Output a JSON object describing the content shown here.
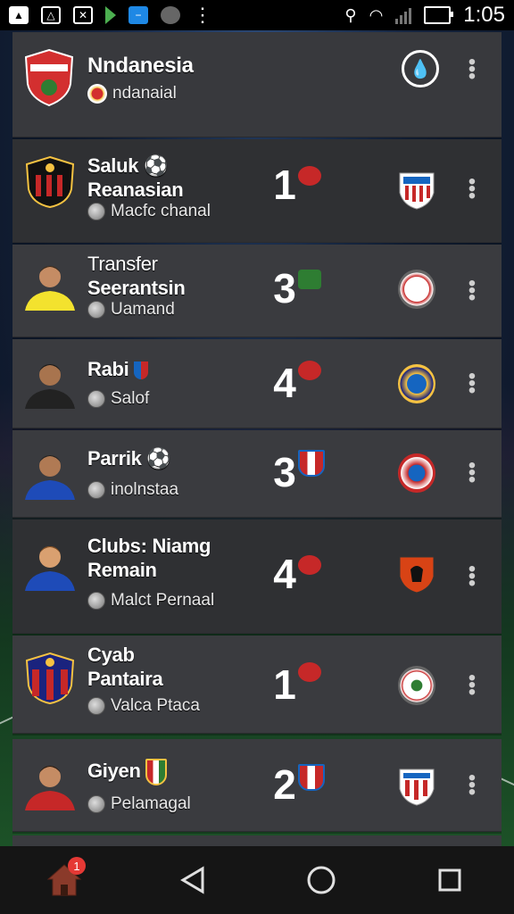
{
  "status_bar": {
    "time": "1:05"
  },
  "header": {
    "title": "Nndanesia",
    "subtitle": "ndanaial"
  },
  "rows": [
    {
      "title_line1": "Saluk",
      "title_line2": "Reanasian",
      "subtitle": "Macfc chanal",
      "score": "1"
    },
    {
      "title_line1": "Transfer",
      "title_line2": "Seerantsin",
      "subtitle": "Uamand",
      "score": "3"
    },
    {
      "title_line1": "Rabi",
      "title_line2": "",
      "subtitle": "Salof",
      "score": "4"
    },
    {
      "title_line1": "Parrik",
      "title_line2": "",
      "subtitle": "inolnstaa",
      "score": "3"
    },
    {
      "title_line1": "Clubs: Niamg",
      "title_line2": "Remain",
      "subtitle": "Malct Pernaal",
      "score": "4"
    },
    {
      "title_line1": "Cyab",
      "title_line2": "Pantaira",
      "subtitle": "Valca Ptaca",
      "score": "1"
    },
    {
      "title_line1": "Giyen",
      "title_line2": "",
      "subtitle": "Pelamagal",
      "score": "2"
    }
  ],
  "nav": {
    "home_badge": "1"
  },
  "colors": {
    "row_bg": "#3a3b3f",
    "row_dark_bg": "#2f3033",
    "badge_red": "#e53935"
  }
}
